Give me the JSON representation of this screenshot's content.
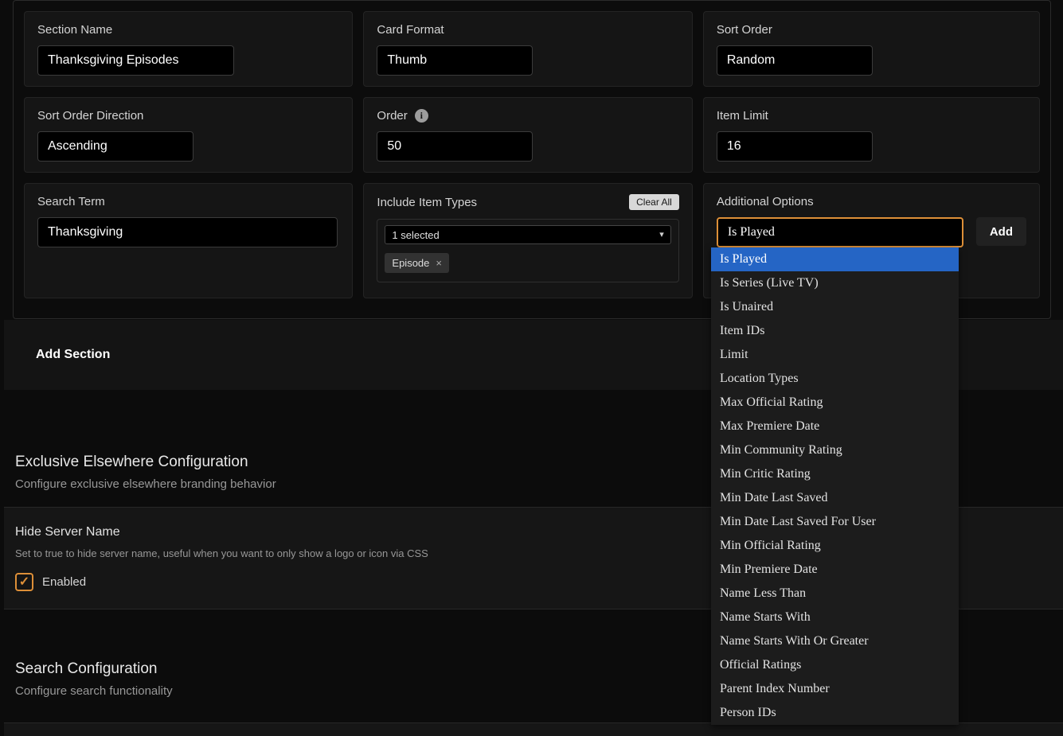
{
  "colors": {
    "accent_orange": "#dd8f38",
    "highlight_blue": "#2565c5"
  },
  "icons": {
    "info": "i",
    "caret_down": "▾",
    "close": "×",
    "check": "✓"
  },
  "section_editor": {
    "fields": {
      "section_name": {
        "label": "Section Name",
        "value": "Thanksgiving Episodes"
      },
      "card_format": {
        "label": "Card Format",
        "value": "Thumb"
      },
      "sort_order": {
        "label": "Sort Order",
        "value": "Random"
      },
      "sort_order_direction": {
        "label": "Sort Order Direction",
        "value": "Ascending"
      },
      "order": {
        "label": "Order",
        "value": "50"
      },
      "item_limit": {
        "label": "Item Limit",
        "value": "16"
      },
      "search_term": {
        "label": "Search Term",
        "value": "Thanksgiving"
      }
    },
    "include_item_types": {
      "label": "Include Item Types",
      "clear_all_label": "Clear All",
      "selected_summary": "1 selected",
      "chips": [
        {
          "label": "Episode"
        }
      ]
    },
    "additional_options": {
      "label": "Additional Options",
      "input_value": "Is Played",
      "add_button_label": "Add",
      "highlighted_option": "Is Played",
      "dropdown_options": [
        "Is Played",
        "Is Series (Live TV)",
        "Is Unaired",
        "Item IDs",
        "Limit",
        "Location Types",
        "Max Official Rating",
        "Max Premiere Date",
        "Min Community Rating",
        "Min Critic Rating",
        "Min Date Last Saved",
        "Min Date Last Saved For User",
        "Min Official Rating",
        "Min Premiere Date",
        "Name Less Than",
        "Name Starts With",
        "Name Starts With Or Greater",
        "Official Ratings",
        "Parent Index Number",
        "Person IDs"
      ]
    },
    "add_section_label": "Add Section"
  },
  "exclusive_elsewhere": {
    "title": "Exclusive Elsewhere Configuration",
    "subtitle": "Configure exclusive elsewhere branding behavior",
    "hide_server_name": {
      "title": "Hide Server Name",
      "description": "Set to true to hide server name, useful when you want to only show a logo or icon via CSS",
      "checkbox_label": "Enabled",
      "checked": true
    }
  },
  "search_configuration": {
    "title": "Search Configuration",
    "subtitle": "Configure search functionality"
  }
}
